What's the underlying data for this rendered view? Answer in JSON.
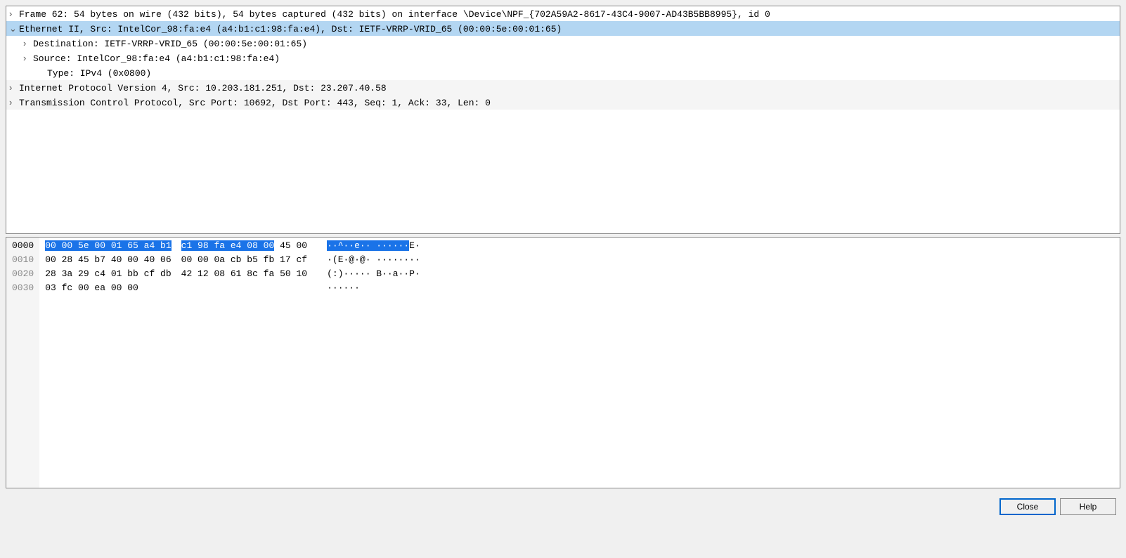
{
  "tree": [
    {
      "level": 1,
      "expander": ">",
      "gray": false,
      "selected": false,
      "text": "Frame 62: 54 bytes on wire (432 bits), 54 bytes captured (432 bits) on interface \\Device\\NPF_{702A59A2-8617-43C4-9007-AD43B5BB8995}, id 0"
    },
    {
      "level": 1,
      "expander": "v",
      "gray": false,
      "selected": true,
      "text": "Ethernet II, Src: IntelCor_98:fa:e4 (a4:b1:c1:98:fa:e4), Dst: IETF-VRRP-VRID_65 (00:00:5e:00:01:65)"
    },
    {
      "level": 2,
      "expander": ">",
      "gray": false,
      "selected": false,
      "text": "Destination: IETF-VRRP-VRID_65 (00:00:5e:00:01:65)"
    },
    {
      "level": 2,
      "expander": ">",
      "gray": false,
      "selected": false,
      "text": "Source: IntelCor_98:fa:e4 (a4:b1:c1:98:fa:e4)"
    },
    {
      "level": 3,
      "expander": "",
      "gray": false,
      "selected": false,
      "text": "Type: IPv4 (0x0800)"
    },
    {
      "level": 1,
      "expander": ">",
      "gray": true,
      "selected": false,
      "text": "Internet Protocol Version 4, Src: 10.203.181.251, Dst: 23.207.40.58"
    },
    {
      "level": 1,
      "expander": ">",
      "gray": true,
      "selected": false,
      "text": "Transmission Control Protocol, Src Port: 10692, Dst Port: 443, Seq: 1, Ack: 33, Len: 0"
    }
  ],
  "hex": {
    "offsets": [
      "0000",
      "0010",
      "0020",
      "0030"
    ],
    "active_offset": 0,
    "rows": [
      {
        "bytes": [
          "00",
          "00",
          "5e",
          "00",
          "01",
          "65",
          "a4",
          "b1",
          "c1",
          "98",
          "fa",
          "e4",
          "08",
          "00",
          "45",
          "00"
        ],
        "hl": [
          0,
          1,
          2,
          3,
          4,
          5,
          6,
          7,
          8,
          9,
          10,
          11,
          12,
          13
        ]
      },
      {
        "bytes": [
          "00",
          "28",
          "45",
          "b7",
          "40",
          "00",
          "40",
          "06",
          "00",
          "00",
          "0a",
          "cb",
          "b5",
          "fb",
          "17",
          "cf"
        ],
        "hl": []
      },
      {
        "bytes": [
          "28",
          "3a",
          "29",
          "c4",
          "01",
          "bb",
          "cf",
          "db",
          "42",
          "12",
          "08",
          "61",
          "8c",
          "fa",
          "50",
          "10"
        ],
        "hl": []
      },
      {
        "bytes": [
          "03",
          "fc",
          "00",
          "ea",
          "00",
          "00"
        ],
        "hl": []
      }
    ],
    "ascii": [
      {
        "text": "··^··e·· ······E·",
        "hl_start": 0,
        "hl_end": 15
      },
      {
        "text": "·(E·@·@· ········",
        "hl_start": 0,
        "hl_end": 0
      },
      {
        "text": "(:)····· B··a··P·",
        "hl_start": 0,
        "hl_end": 0
      },
      {
        "text": "······",
        "hl_start": 0,
        "hl_end": 0
      }
    ]
  },
  "buttons": {
    "close": "Close",
    "help": "Help"
  }
}
